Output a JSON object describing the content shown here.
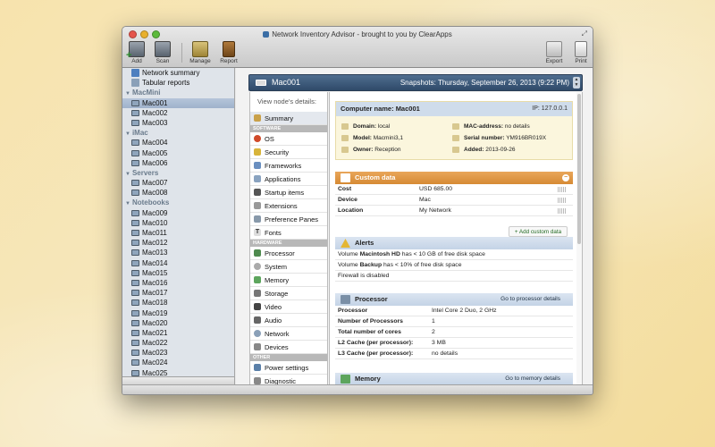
{
  "window": {
    "title": "Network Inventory Advisor - brought to you by ClearApps"
  },
  "toolbar": {
    "add_label": "Add",
    "scan_label": "Scan",
    "manage_label": "Manage",
    "report_label": "Report",
    "export_label": "Export",
    "print_label": "Print"
  },
  "sidebar": {
    "top_items": [
      "Network summary",
      "Tabular reports"
    ],
    "groups": [
      {
        "name": "MacMini",
        "items": [
          "Mac001",
          "Mac002",
          "Mac003"
        ]
      },
      {
        "name": "iMac",
        "items": [
          "Mac004",
          "Mac005",
          "Mac006"
        ]
      },
      {
        "name": "Servers",
        "items": [
          "Mac007",
          "Mac008"
        ]
      },
      {
        "name": "Notebooks",
        "items": [
          "Mac009",
          "Mac010",
          "Mac011",
          "Mac012",
          "Mac013",
          "Mac014",
          "Mac015",
          "Mac016",
          "Mac017",
          "Mac018",
          "Mac019",
          "Mac020",
          "Mac021",
          "Mac022",
          "Mac023",
          "Mac024",
          "Mac025"
        ]
      }
    ],
    "selected": "Mac001"
  },
  "node": {
    "name": "Mac001",
    "snapshots": "Snapshots:  Thursday, September 26, 2013 (9:22 PM)"
  },
  "details_nav": {
    "title": "View node's details:",
    "summary": "Summary",
    "sections": [
      {
        "name": "SOFTWARE",
        "items": [
          "OS",
          "Security",
          "Frameworks",
          "Applications",
          "Startup items",
          "Extensions",
          "Preference Panes",
          "Fonts"
        ]
      },
      {
        "name": "HARDWARE",
        "items": [
          "Processor",
          "System",
          "Memory",
          "Storage",
          "Video",
          "Audio",
          "Network",
          "Devices"
        ]
      },
      {
        "name": "OTHER",
        "items": [
          "Power settings",
          "Diagnostic"
        ]
      }
    ]
  },
  "computer": {
    "name_label": "Computer name:",
    "name": "Mac001",
    "ip": "IP:  127.0.0.1",
    "domain_label": "Domain:",
    "domain": "local",
    "model_label": "Model:",
    "model": "Macmini3,1",
    "owner_label": "Owner:",
    "owner": "Reception",
    "mac_label": "MAC-address:",
    "mac": "no details",
    "serial_label": "Serial number:",
    "serial": "YM916BR019X",
    "added_label": "Added:",
    "added": "2013-09-26"
  },
  "custom_data": {
    "title": "Custom data",
    "rows": [
      {
        "k": "Cost",
        "v": "USD 685.00"
      },
      {
        "k": "Device",
        "v": "Mac"
      },
      {
        "k": "Location",
        "v": "My Network"
      }
    ],
    "add_label": "Add custom data"
  },
  "alerts": {
    "title": "Alerts",
    "a1_pre": "Volume ",
    "a1_bold": "Macintosh HD",
    "a1_post": " has < 10 GB of free disk space",
    "a2_pre": "Volume ",
    "a2_bold": "Backup",
    "a2_post": " has < 10% of free disk space",
    "a3": "Firewall is disabled"
  },
  "processor": {
    "title": "Processor",
    "go": "Go to processor details",
    "rows": [
      {
        "k": "Processor",
        "v": "Intel Core 2 Duo, 2 GHz"
      },
      {
        "k": "Number of Processors",
        "v": "1"
      },
      {
        "k": "Total number of cores",
        "v": "2"
      },
      {
        "k": "L2 Cache (per processor):",
        "v": "3 MB"
      },
      {
        "k": "L3 Cache (per processor):",
        "v": "no details"
      }
    ]
  },
  "memory": {
    "title": "Memory",
    "go": "Go to memory details"
  }
}
